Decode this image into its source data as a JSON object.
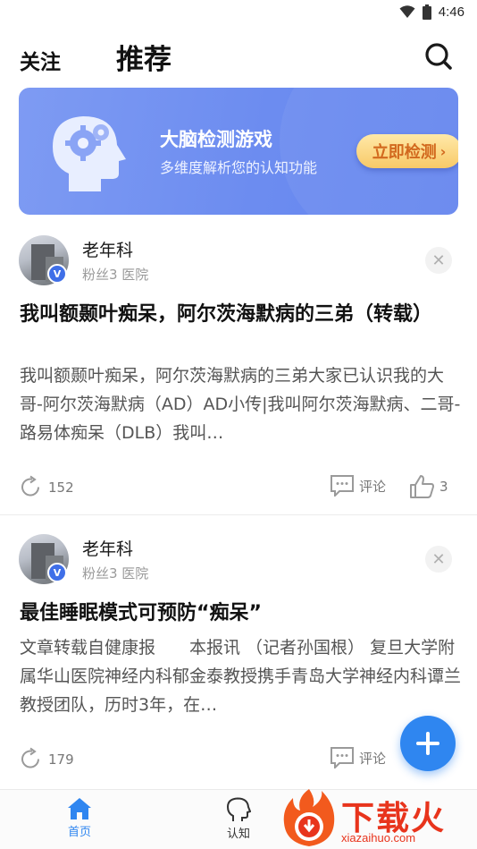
{
  "status_bar": {
    "time": "4:46"
  },
  "top_nav": {
    "tab_follow": "关注",
    "tab_recommend": "推荐",
    "search_icon": "search-icon"
  },
  "banner": {
    "title": "大脑检测游戏",
    "subtitle": "多维度解析您的认知功能",
    "cta_label": "立即检测",
    "cta_chevron": "›",
    "icon": "brain-gears-icon"
  },
  "posts": [
    {
      "author": "老年科",
      "verified_badge": "V",
      "meta": "粉丝3  医院",
      "title": "我叫额颞叶痴呆，阿尔茨海默病的三弟（转载）",
      "excerpt": "我叫额颞叶痴呆，阿尔茨海默病的三弟大家已认识我的大哥-阿尔茨海默病（AD）AD小传|我叫阿尔茨海默病、二哥-路易体痴呆（DLB）我叫…",
      "shares": "152",
      "comment_label": "评论",
      "likes": "3"
    },
    {
      "author": "老年科",
      "verified_badge": "V",
      "meta": "粉丝3  医院",
      "title": "最佳睡眠模式可预防“痴呆”",
      "excerpt": "文章转载自健康报　　本报讯 （记者孙国根） 复旦大学附属华山医院神经内科郁金泰教授携手青岛大学神经内科谭兰教授团队，历时3年，在…",
      "shares": "179",
      "comment_label": "评论",
      "likes": ""
    }
  ],
  "bottom_nav": {
    "items": [
      {
        "label": "首页",
        "icon": "home-icon",
        "active": true
      },
      {
        "label": "认知",
        "icon": "head-icon",
        "active": false
      }
    ]
  },
  "watermark": {
    "text": "下载火",
    "url": "xiazaihuo.com"
  },
  "colors": {
    "accent": "#2f86f0",
    "banner": "#6c8cf0",
    "cta_text": "#d2691e",
    "watermark": "#e8341c"
  }
}
